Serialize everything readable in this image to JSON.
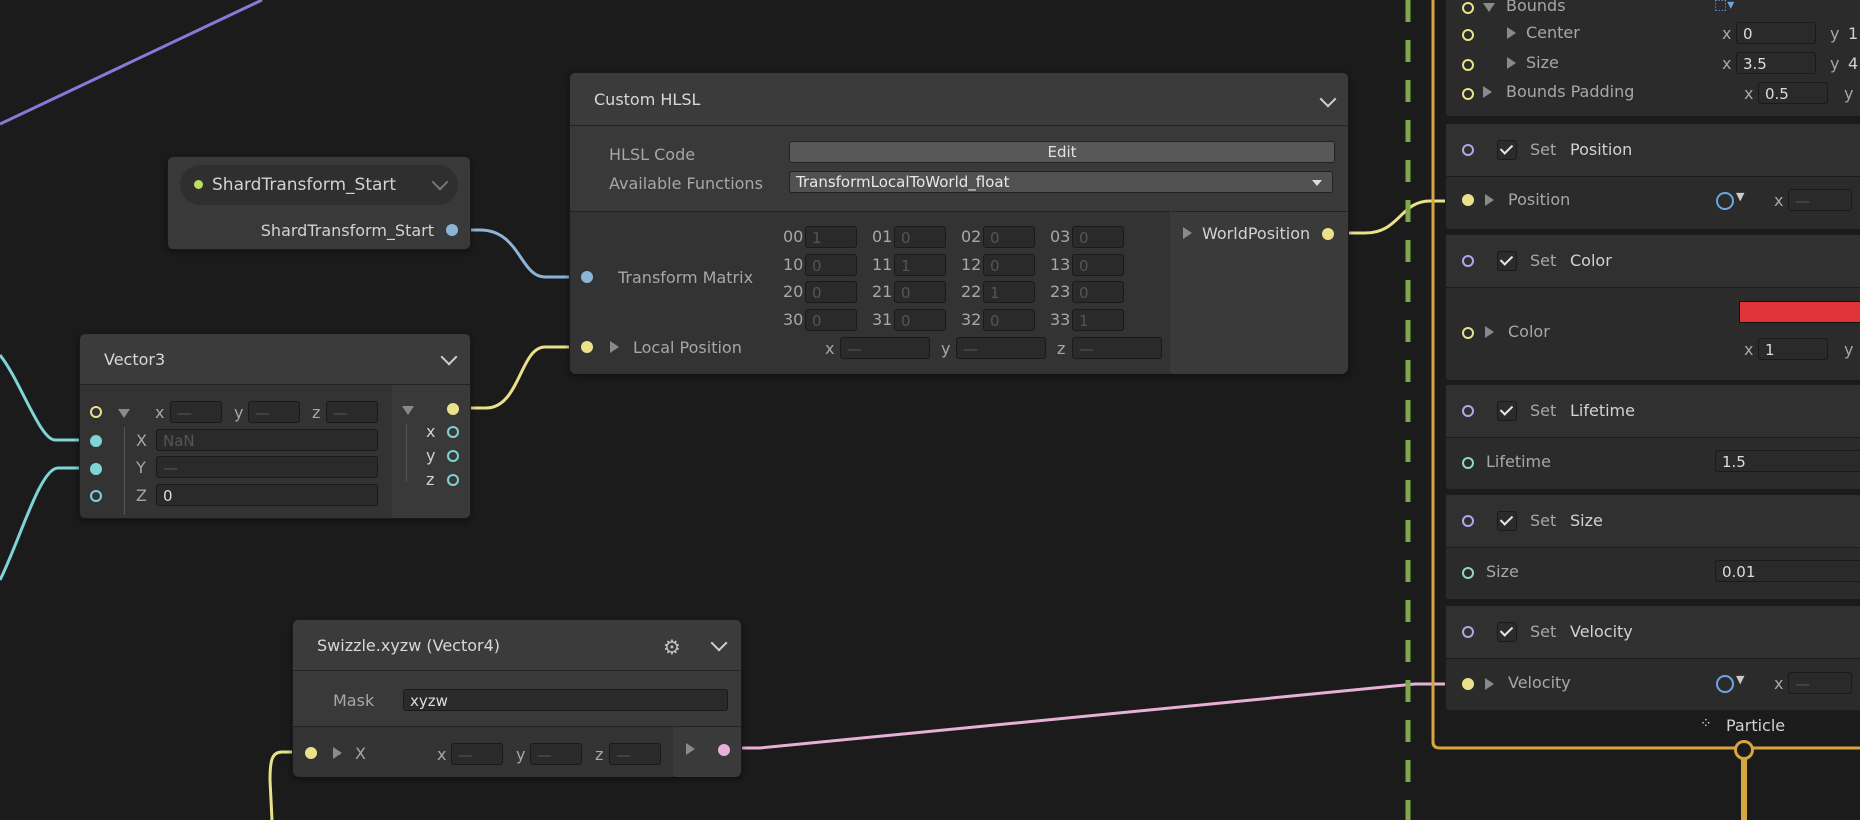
{
  "shard_node": {
    "title": "ShardTransform_Start",
    "output_label": "ShardTransform_Start"
  },
  "vector3_node": {
    "title": "Vector3",
    "x_label": "x",
    "y_label": "y",
    "z_label": "z",
    "X_label": "X",
    "X_value": "NaN",
    "Y_label": "Y",
    "Y_value": "—",
    "Z_label": "Z",
    "Z_value": "0",
    "dash": "—"
  },
  "hlsl_node": {
    "title": "Custom HLSL",
    "code_label": "HLSL Code",
    "edit_button": "Edit",
    "functions_label": "Available Functions",
    "functions_value": "TransformLocalToWorld_float",
    "matrix_label": "Transform Matrix",
    "matrix": [
      {
        "row": "00",
        "val": "1"
      },
      {
        "row": "01",
        "val": "0"
      },
      {
        "row": "02",
        "val": "0"
      },
      {
        "row": "03",
        "val": "0"
      },
      {
        "row": "10",
        "val": "0"
      },
      {
        "row": "11",
        "val": "1"
      },
      {
        "row": "12",
        "val": "0"
      },
      {
        "row": "13",
        "val": "0"
      },
      {
        "row": "20",
        "val": "0"
      },
      {
        "row": "21",
        "val": "0"
      },
      {
        "row": "22",
        "val": "1"
      },
      {
        "row": "23",
        "val": "0"
      },
      {
        "row": "30",
        "val": "0"
      },
      {
        "row": "31",
        "val": "0"
      },
      {
        "row": "32",
        "val": "0"
      },
      {
        "row": "33",
        "val": "1"
      }
    ],
    "local_position_label": "Local Position",
    "x": "x",
    "y": "y",
    "z": "z",
    "dash": "—",
    "output_label": "WorldPosition"
  },
  "swizzle_node": {
    "title": "Swizzle.xyzw (Vector4)",
    "mask_label": "Mask",
    "mask_value": "xyzw",
    "input_label": "X",
    "x": "x",
    "y": "y",
    "z": "z",
    "dash": "—"
  },
  "context": {
    "bounds_label": "Bounds",
    "center_label": "Center",
    "center_x": "0",
    "center_y_partial": "1",
    "size_label": "Size",
    "size_x": "3.5",
    "size_y_partial": "4",
    "bounds_padding_label": "Bounds Padding",
    "bounds_padding_x": "0.5",
    "x": "x",
    "y": "y",
    "dash": "—",
    "set_position": {
      "set": "Set",
      "name": "Position",
      "attr": "Position"
    },
    "set_color": {
      "set": "Set",
      "name": "Color",
      "attr": "Color",
      "x_value": "1",
      "swatch": "#e0333a"
    },
    "set_lifetime": {
      "set": "Set",
      "name": "Lifetime",
      "attr": "Lifetime",
      "value": "1.5"
    },
    "set_size": {
      "set": "Set",
      "name": "Size",
      "attr": "Size",
      "value": "0.01"
    },
    "set_velocity": {
      "set": "Set",
      "name": "Velocity",
      "attr": "Velocity"
    },
    "particle_label": "Particle"
  },
  "colors": {
    "context_border": "#d6a640",
    "dash_line": "#7fa84a",
    "wire_yellow": "#e9e28a",
    "wire_cyan": "#7fd4d6",
    "wire_blue": "#8ab4d8",
    "wire_pink": "#e7b0d6",
    "wire_purple": "#8a78d8"
  }
}
